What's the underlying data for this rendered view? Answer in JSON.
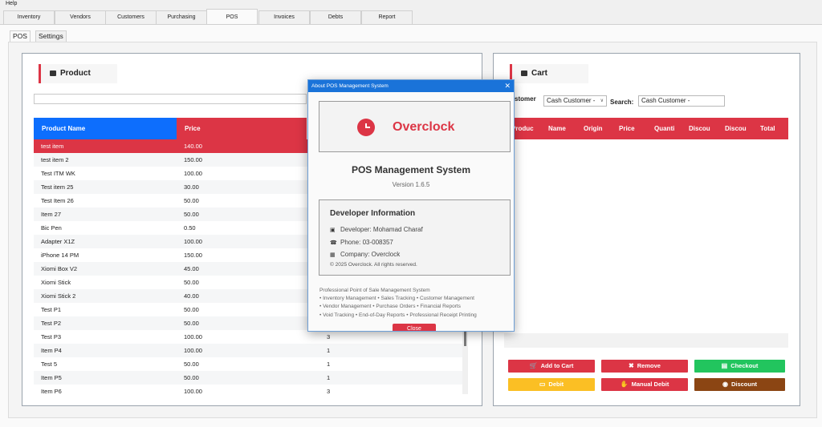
{
  "menu": {
    "help": "Help"
  },
  "main_tabs": [
    "Inventory",
    "Vendors",
    "Customers",
    "Purchasing",
    "POS",
    "Invoices",
    "Debts",
    "Report"
  ],
  "sub_tabs": [
    "POS",
    "Settings"
  ],
  "product_panel": {
    "title": "Product",
    "columns": [
      "Product Name",
      "Price"
    ],
    "rows": [
      [
        "test item",
        "140.00",
        ""
      ],
      [
        "test item 2",
        "150.00",
        ""
      ],
      [
        "Test ITM WK",
        "100.00",
        ""
      ],
      [
        "Test item 25",
        "30.00",
        ""
      ],
      [
        "Test Item 26",
        "50.00",
        ""
      ],
      [
        "Item 27",
        "50.00",
        ""
      ],
      [
        "Bic Pen",
        "0.50",
        ""
      ],
      [
        "Adapter X1Z",
        "100.00",
        ""
      ],
      [
        "iPhone 14 PM",
        "150.00",
        ""
      ],
      [
        "Xiomi Box V2",
        "45.00",
        ""
      ],
      [
        "Xiomi Stick",
        "50.00",
        ""
      ],
      [
        "Xiomi Stick 2",
        "40.00",
        ""
      ],
      [
        "Test P1",
        "50.00",
        ""
      ],
      [
        "Test P2",
        "50.00",
        ""
      ],
      [
        "Test P3",
        "100.00",
        "3"
      ],
      [
        "Item P4",
        "100.00",
        "1"
      ],
      [
        "Test 5",
        "50.00",
        "1"
      ],
      [
        "Item P5",
        "50.00",
        "1"
      ],
      [
        "Item P6",
        "100.00",
        "3"
      ]
    ]
  },
  "cart_panel": {
    "title": "Cart",
    "customer_label": "stomer",
    "customer_value": "Cash Customer -",
    "search_label": "Search:",
    "search_value": "Cash Customer -",
    "columns": [
      "Produc",
      "Name",
      "Origin",
      "Price",
      "Quanti",
      "Discou",
      "Discou",
      "Total"
    ]
  },
  "buttons": {
    "add_to_cart": "Add to Cart",
    "remove": "Remove",
    "checkout": "Checkout",
    "debit": "Debit",
    "manual_debit": "Manual Debit",
    "discount": "Discount"
  },
  "colors": {
    "accent_red": "#dc3545",
    "selected_blue": "#0d6efd",
    "checkout_green": "#22c55e",
    "debit_yellow": "#fbbf24",
    "discount_brown": "#8b4513"
  },
  "about_dialog": {
    "window_title": "About POS Management System",
    "close_glyph": "✕",
    "logo_text": "Overclock",
    "system_name": "POS Management System",
    "version": "Version 1.6.5",
    "developer_section_title": "Developer Information",
    "developer": "Developer: Mohamad Charaf",
    "phone": "Phone: 03-008357",
    "company": "Company: Overclock",
    "copyright": "© 2025 Overclock. All rights reserved.",
    "features": [
      "Professional Point of Sale Management System",
      "• Inventory Management • Sales Tracking • Customer Management",
      "• Vendor Management • Purchase Orders • Financial Reports",
      "• Void Tracking • End-of-Day Reports • Professional Receipt Printing"
    ],
    "close_button": "Close"
  }
}
